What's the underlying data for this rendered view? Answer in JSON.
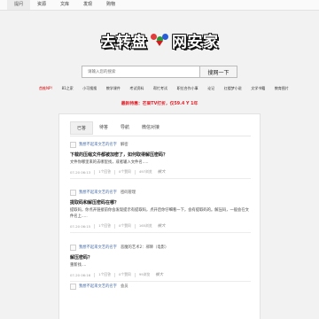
{
  "topnav": {
    "items": [
      "提问",
      "资源",
      "文库",
      "发现",
      "购物"
    ],
    "active": 0
  },
  "logo": {
    "left_text": "去转盘",
    "right_text": "网安家"
  },
  "search": {
    "placeholder": "请输入您的搜索",
    "button_label": "搜网一下"
  },
  "categories": [
    "首推NP!",
    "81之家",
    "小可搜搜",
    "教学课件",
    "考试资料",
    "帮忙考试",
    "职位合作小事",
    "论记",
    "红楼梦小说",
    "文学书籍",
    "教育图片"
  ],
  "notice": "最新特惠：芒果TV打折，仅59.4 Y 1年",
  "tabs": [
    "已答",
    "待答",
    "导航",
    "微信对接"
  ],
  "posts": [
    {
      "author": "我想不起来文艺的名字",
      "category": "解密",
      "title": "下载的压缩文件都被加密了，如何取得解压密码？",
      "desc": "文件你哪里来的去哪里找，或者输入文件名.....",
      "date": "07-20 06:13",
      "answers": "1个回答",
      "likes": "0个赞同",
      "views": "497浏览",
      "sig": "被大"
    },
    {
      "author": "我想不起来文艺的名字",
      "category": "密码管理",
      "title": "提取码和解压密码在哪？",
      "desc": "提取码，你点开链接前你会发现提示有提取码，点开后你仔细看一下，会有提取码的。解压码，一般会在文件名上.....",
      "date": "07-20 06:15",
      "answers": "1个回答",
      "likes": "0个赞同",
      "views": "165浏览",
      "sig": "被大"
    },
    {
      "author": "我想不起来文艺的名字",
      "category": "恶魔的艺术2：邪降（电影）",
      "title": "解压密码？",
      "desc": "重新找....",
      "date": "07-20 06:16",
      "answers": "1个回答",
      "likes": "0个赞同",
      "views": "99浏览",
      "sig": "被大"
    },
    {
      "author": "我想不起来文艺的名字",
      "category": "会员"
    }
  ]
}
